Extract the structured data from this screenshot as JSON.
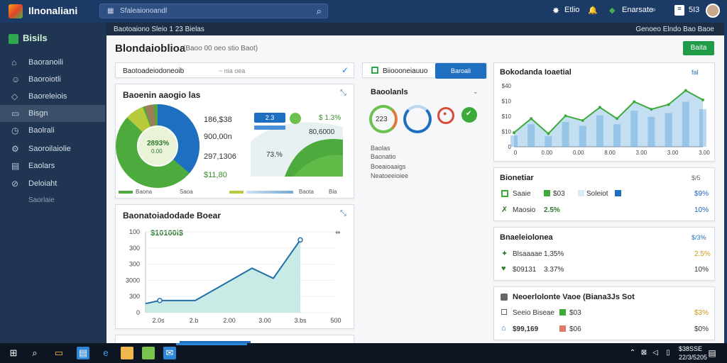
{
  "topbar": {
    "title": "Ilnonaliani",
    "search_placeholder": "Sfaleaionoandl",
    "right_items": [
      "Etlio",
      "Enarsate",
      "5I3"
    ]
  },
  "sidebar": {
    "brand": "Bisils",
    "items": [
      {
        "label": "Baoranoili",
        "icon": "home-icon"
      },
      {
        "label": "Baoroiotli",
        "icon": "user-icon"
      },
      {
        "label": "Baoreleiois",
        "icon": "shield-icon"
      },
      {
        "label": "Bisgn",
        "icon": "layers-icon"
      },
      {
        "label": "Baolrali",
        "icon": "clock-icon"
      },
      {
        "label": "Saoroilaiolie",
        "icon": "settings-icon"
      },
      {
        "label": "Eaolars",
        "icon": "calendar-icon"
      },
      {
        "label": "Deloiaht",
        "icon": "pin-icon"
      },
      {
        "label": "Saorlaie",
        "icon": ""
      }
    ],
    "active_index": 3
  },
  "subbar": {
    "left": "Baotoaiono Sleio 1 23 Bielas",
    "right": "Genoeo Elndo Bao Baoe"
  },
  "page": {
    "title": "Blondaioblioa",
    "subtitle": "(Baoo 00 oeo stio Baot)",
    "action_button": "Baita"
  },
  "filter_bar": {
    "label": "Baotoadeiodoneoib",
    "value": "~ nia oea"
  },
  "donut_card": {
    "title": "Baoenin aaogio las",
    "center_value": "2893%",
    "center_sub": "0.00",
    "stats": [
      {
        "value": "186,$38",
        "color": "#333333"
      },
      {
        "value": "900,00n",
        "color": "#333333"
      },
      {
        "value": "297,1306",
        "color": "#333333"
      },
      {
        "value": "$11,80",
        "color": "#333333"
      }
    ],
    "tags": [
      "2.3",
      "$ 1.3%"
    ],
    "mini": [
      "80,6000",
      "73.%"
    ],
    "legend": [
      "Baona",
      "Saoa",
      "Baota",
      "Bia"
    ]
  },
  "area_card": {
    "title": "Baonatoiadodade Boear",
    "callout": "$10100i$",
    "y_ticks": [
      "100",
      "300",
      "300",
      "3000",
      "300",
      "0"
    ],
    "x_ticks": [
      "2.0s",
      "2.b",
      "2.00",
      "3.00",
      "3.bs",
      "500"
    ]
  },
  "middle_panel": {
    "tab_label": "Biioooneiauuo",
    "tab_button": "Baroali",
    "title": "Baoolanls",
    "gauges": [
      "223",
      "",
      "",
      ""
    ],
    "list": [
      "Baolas",
      "Baonatio",
      "Boeaioaaigs",
      "Neatoeeioiee"
    ]
  },
  "line_card": {
    "title": "Bokodanda Ioaetial",
    "y_ticks": [
      "$40",
      "$10",
      "$10",
      "$10",
      "0"
    ],
    "x_ticks": [
      "0",
      "0.00",
      "0.00",
      "8.00",
      "3.00",
      "3.00",
      "3.00"
    ],
    "corner": "fal"
  },
  "list_card1": {
    "title": "Bionetiar",
    "right": "$/5",
    "rows": [
      {
        "label": "Saaie",
        "tag": "$03",
        "val2": "Soleiot",
        "pct": "$9%",
        "pct_color": "#1f5fbf"
      },
      {
        "label": "Maosio",
        "tag": "2.5%",
        "val2": "",
        "pct": "10%",
        "pct_color": "#1f5fbf"
      }
    ]
  },
  "list_card2": {
    "title": "Bnaeleiolonea",
    "right": "$/3%",
    "rows": [
      {
        "label": "Blsaaaae",
        "tag": "1,35%",
        "pct": "2.5%",
        "pct_color": "#c89a1a"
      },
      {
        "label": "$09131",
        "tag": "3.37%",
        "pct": "10%",
        "pct_color": "#333333"
      }
    ]
  },
  "list_card3": {
    "title": "Neoerlolonte Vaoe (Biana3Js Sot",
    "rows": [
      {
        "label": "Seeio Biseae",
        "tag": "$03",
        "pct": "$3%",
        "pct_color": "#c89a1a"
      },
      {
        "label": "$99,169",
        "tag": "$06",
        "pct": "$0%",
        "pct_color": "#333333"
      }
    ]
  },
  "taskbar": {
    "time": "$38SSE",
    "date": "22/3/5205"
  },
  "colors": {
    "brand": "#1c3a66",
    "accent_green": "#3cab3a",
    "accent_blue": "#1f6fc0",
    "teal": "#3fb3a9"
  },
  "chart_data": [
    {
      "type": "area",
      "x": [
        "2.0s",
        "2.b",
        "2.00",
        "3.00",
        "3.bs",
        "500"
      ],
      "values": [
        100,
        110,
        300,
        380,
        440,
        700
      ],
      "yticks": [
        "100",
        "300",
        "300",
        "3000",
        "300",
        "0"
      ]
    },
    {
      "type": "line",
      "x": [
        "0",
        "0.00",
        "0.00",
        "8.00",
        "3.00",
        "3.00",
        "3.00"
      ],
      "values": [
        15,
        30,
        14,
        33,
        28,
        42,
        30,
        48,
        40,
        45,
        60,
        50
      ],
      "yticks": [
        "$40",
        "$10",
        "$10",
        "$10",
        "0"
      ]
    }
  ]
}
